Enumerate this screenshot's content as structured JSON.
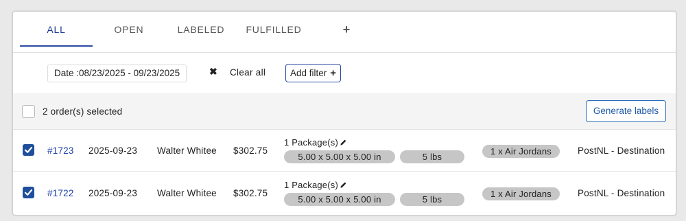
{
  "tabs": [
    {
      "label": "ALL",
      "active": true
    },
    {
      "label": "OPEN",
      "active": false
    },
    {
      "label": "LABELED",
      "active": false
    },
    {
      "label": "FULFILLED",
      "active": false
    }
  ],
  "tab_add_icon": "plus-icon",
  "filters": {
    "date_chip": "Date :08/23/2025 - 09/23/2025",
    "clear_all": "Clear all",
    "add_filter": "Add filter"
  },
  "selection": {
    "text": "2 order(s) selected",
    "generate_labels": "Generate labels"
  },
  "orders": [
    {
      "selected": true,
      "number": "#1723",
      "date": "2025-09-23",
      "customer": "Walter Whitee",
      "total": "$302.75",
      "packages": "1 Package(s)",
      "dimensions": "5.00 x 5.00 x 5.00 in",
      "weight": "5 lbs",
      "items": "1 x Air Jordans",
      "carrier": "PostNL - Destination"
    },
    {
      "selected": true,
      "number": "#1722",
      "date": "2025-09-23",
      "customer": "Walter Whitee",
      "total": "$302.75",
      "packages": "1 Package(s)",
      "dimensions": "5.00 x 5.00 x 5.00 in",
      "weight": "5 lbs",
      "items": "1 x Air Jordans",
      "carrier": "PostNL - Destination"
    }
  ],
  "colors": {
    "accent": "#2c4aa3",
    "link": "#1c3fa8",
    "checkbox": "#1f4f9c",
    "pill": "#c6c6c6"
  }
}
